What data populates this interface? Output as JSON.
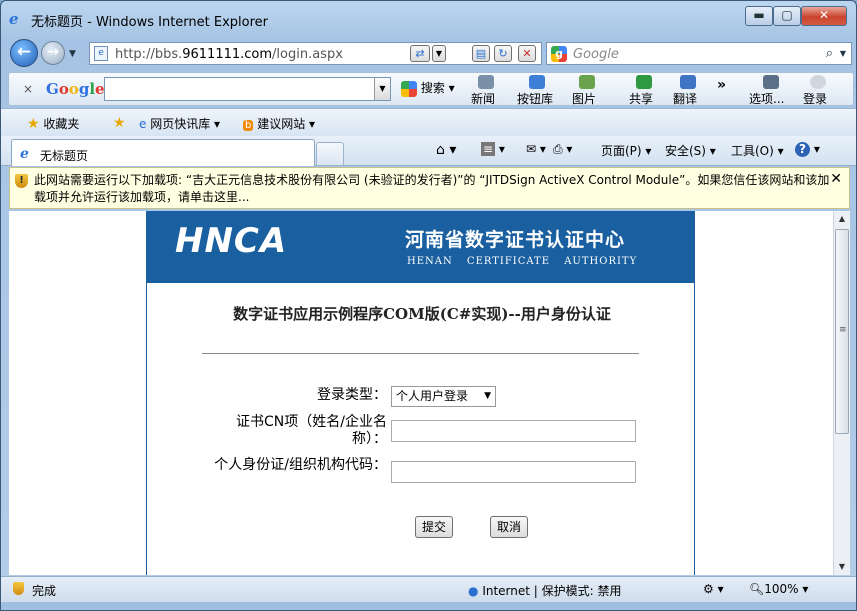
{
  "window": {
    "title": "无标题页 - Windows Internet Explorer",
    "controls": {
      "minimize": "▬",
      "maximize": "▢",
      "close": "✕"
    }
  },
  "address": {
    "url_prefix": "http://bbs.",
    "url_domain": "9611111.com",
    "url_path": "/login.aspx"
  },
  "search": {
    "placeholder": "Google"
  },
  "google_toolbar": {
    "close": "×",
    "logo": [
      "G",
      "o",
      "o",
      "g",
      "l",
      "e"
    ],
    "search_label": "搜索",
    "tools": [
      {
        "label": "新闻",
        "color": "#7a8fa8"
      },
      {
        "label": "按钮库",
        "color": "#3d7fd6"
      },
      {
        "label": "图片",
        "color": "#6aa34b"
      },
      {
        "label": "共享",
        "color": "#2e9a40"
      },
      {
        "label": "翻译",
        "color": "#3f73c4"
      },
      {
        "label": "选项...",
        "color": "#5b6f86"
      },
      {
        "label": "登录",
        "color": "#cfd6de"
      }
    ],
    "more": "»"
  },
  "favorites": {
    "label": "收藏夹",
    "items": [
      "网页快讯库",
      "建议网站"
    ]
  },
  "tab": {
    "label": "无标题页"
  },
  "commands": {
    "page": "页面(P)",
    "safety": "安全(S)",
    "tools": "工具(O)"
  },
  "infobar": {
    "message": "此网站需要运行以下加载项: “吉大正元信息技术股份有限公司 (未验证的发行者)”的 “JITDSign ActiveX Control Module”。如果您信任该网站和该加载项并允许运行该加载项，请单击这里..."
  },
  "banner": {
    "logo": "HNCA",
    "name_cn": "河南省数字证书认证中心",
    "name_en": "HENAN CERTIFICATE AUTHORITY"
  },
  "form": {
    "heading": "数字证书应用示例程序COM版(C#实现)--用户身份认证",
    "login_type_label": "登录类型：",
    "login_type_value": "个人用户登录",
    "cn_label": "证书CN项（姓名/企业名称）：",
    "id_label": "个人身份证/组织机构代码：",
    "submit": "提交",
    "cancel": "取消"
  },
  "statusbar": {
    "status": "完成",
    "zone": "Internet | 保护模式: 禁用",
    "zoom": "100%"
  }
}
